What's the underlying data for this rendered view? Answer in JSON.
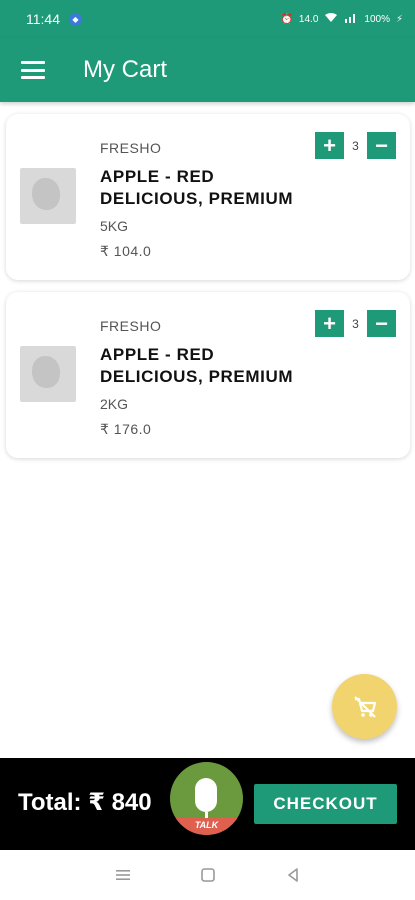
{
  "status_bar": {
    "time": "11:44",
    "data_speed": "14.0",
    "battery": "100%"
  },
  "app_bar": {
    "title": "My Cart"
  },
  "cart_items": [
    {
      "brand": "FRESHO",
      "name": "APPLE - RED DELICIOUS, PREMIUM",
      "weight": "5KG",
      "price": "₹ 104.0",
      "quantity": "3",
      "plus": "+",
      "minus": "−"
    },
    {
      "brand": "FRESHO",
      "name": "APPLE - RED DELICIOUS, PREMIUM",
      "weight": "2KG",
      "price": "₹ 176.0",
      "quantity": "3",
      "plus": "+",
      "minus": "−"
    }
  ],
  "footer": {
    "total": "Total: ₹ 840",
    "talk_label": "TALK",
    "checkout_label": "CHECKOUT"
  },
  "colors": {
    "primary": "#1e9a78",
    "fab": "#f2d46f",
    "mic": "#6b9a3e",
    "talk": "#e06050"
  },
  "icons": {
    "menu": "hamburger-menu-icon",
    "clear_cart": "remove-cart-icon",
    "mic": "microphone-icon"
  }
}
